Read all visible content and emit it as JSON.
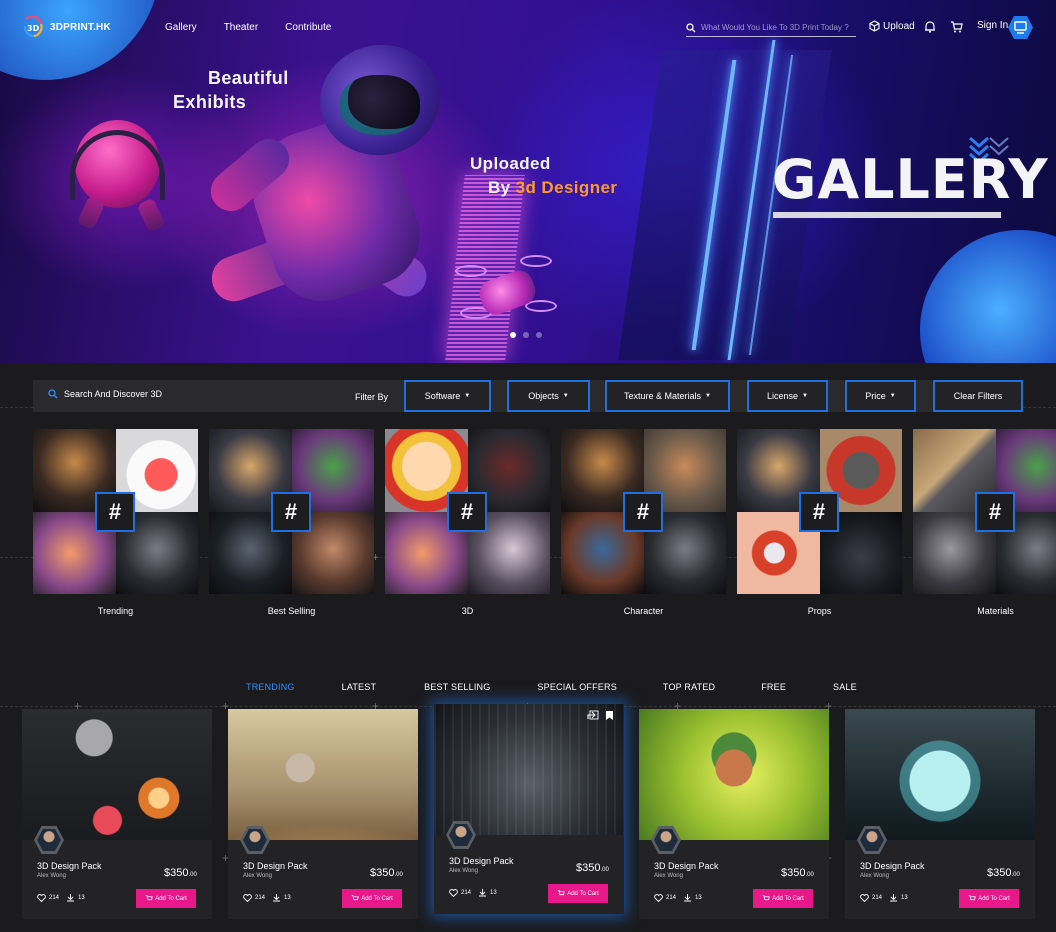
{
  "nav": {
    "logo_text": "3DPRINT.HK",
    "links": [
      "Gallery",
      "Theater",
      "Contribute"
    ],
    "search_placeholder": "What Would You Like To 3D Print Today ?",
    "upload_label": "Upload",
    "signin_label": "Sign In"
  },
  "hero": {
    "line1a": "Beautiful",
    "line1b": "Exhibits",
    "line2a": "Uploaded",
    "line2b_prefix": "By ",
    "line2b_accent": "3d Designer",
    "big_title": "GALLERY",
    "accent_color": "#ff9a2a",
    "slide_count": 3,
    "active_slide": 1
  },
  "filters": {
    "search_label": "Search And Discover 3D",
    "filter_by_label": "Filter By",
    "buttons": [
      "Software",
      "Objects",
      "Texture & Materials",
      "License",
      "Price"
    ],
    "clear_label": "Clear Filters",
    "accent_color": "#1f6fe0"
  },
  "categories": [
    {
      "label": "Trending",
      "icon": "hash-icon"
    },
    {
      "label": "Best Selling",
      "icon": "hash-icon"
    },
    {
      "label": "3D",
      "icon": "hash-icon"
    },
    {
      "label": "Character",
      "icon": "hash-icon"
    },
    {
      "label": "Props",
      "icon": "hash-icon"
    },
    {
      "label": "Materials",
      "icon": "hash-icon"
    }
  ],
  "tabs": {
    "items": [
      "TRENDING",
      "LATEST",
      "BEST SELLING",
      "SPECIAL OFFERS",
      "TOP RATED",
      "FREE",
      "SALE"
    ],
    "active": 0,
    "active_color": "#2f8fff"
  },
  "products": [
    {
      "title": "3D Design Pack",
      "author": "Alex Wong",
      "price": "$350",
      "cents": ".00",
      "likes": "214",
      "downloads": "13",
      "cart_label": "Add To Cart"
    },
    {
      "title": "3D Design Pack",
      "author": "Alex Wong",
      "price": "$350",
      "cents": ".00",
      "likes": "214",
      "downloads": "13",
      "cart_label": "Add To Cart"
    },
    {
      "title": "3D Design Pack",
      "author": "Alex Wong",
      "price": "$350",
      "cents": ".00",
      "likes": "214",
      "downloads": "13",
      "cart_label": "Add To Cart"
    },
    {
      "title": "3D Design Pack",
      "author": "Alex Wong",
      "price": "$350",
      "cents": ".00",
      "likes": "214",
      "downloads": "13",
      "cart_label": "Add To Cart"
    },
    {
      "title": "3D Design Pack",
      "author": "Alex Wong",
      "price": "$350",
      "cents": ".00",
      "likes": "214",
      "downloads": "13",
      "cart_label": "Add To Cart"
    }
  ],
  "colors": {
    "cart_button": "#e8188a",
    "page_bg": "#1b1b1d"
  }
}
